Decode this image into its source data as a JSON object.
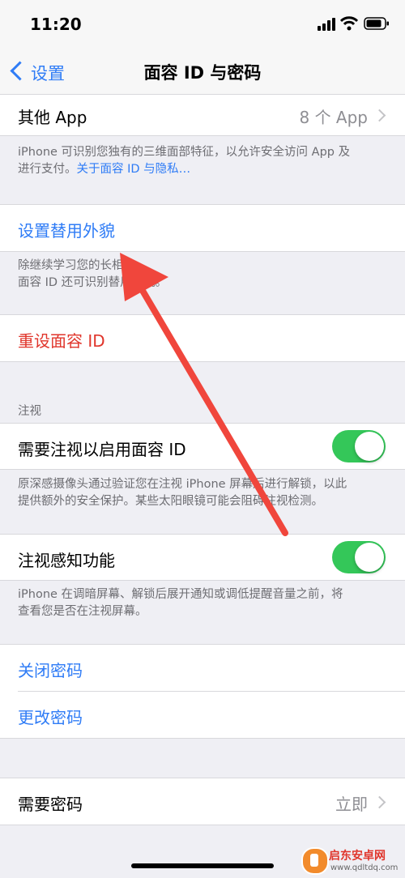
{
  "status_bar": {
    "time": "11:20"
  },
  "nav": {
    "back_label": "设置",
    "title": "面容 ID 与密码"
  },
  "other_apps": {
    "label": "其他 App",
    "value": "8 个 App"
  },
  "face_id_footer": {
    "line1": "iPhone 可识别您独有的三维面部特征，以允许安全访问 App 及",
    "line2_prefix": "进行支付。",
    "link": "关于面容 ID 与隐私…"
  },
  "alternate_appearance": {
    "label": "设置替用外貌"
  },
  "alternate_footer": {
    "line1": "除继续学习您的长相外，",
    "line2": "面容 ID 还可识别替用外貌。"
  },
  "reset_face_id": {
    "label": "重设面容 ID"
  },
  "attention": {
    "section_header": "注视",
    "require_attention": {
      "label": "需要注视以启用面容 ID",
      "enabled": true
    },
    "require_footer": {
      "line1": "原深感摄像头通过验证您在注视 iPhone 屏幕后进行解锁，以此",
      "line2": "提供额外的安全保护。某些太阳眼镜可能会阻碍注视检测。"
    },
    "aware_features": {
      "label": "注视感知功能",
      "enabled": true
    },
    "aware_footer": {
      "line1": "iPhone 在调暗屏幕、解锁后展开通知或调低提醒音量之前，将",
      "line2": "查看您是否在注视屏幕。"
    }
  },
  "passcode": {
    "turn_off": "关闭密码",
    "change": "更改密码"
  },
  "require_passcode": {
    "label": "需要密码",
    "value": "立即"
  },
  "watermark": {
    "text": "启东安卓网",
    "url": "www.qdltdq.com"
  },
  "colors": {
    "accent_blue": "#2f7cf6",
    "destructive_red": "#e0352b",
    "toggle_green": "#34c759",
    "annotation_arrow": "#f0463c"
  }
}
